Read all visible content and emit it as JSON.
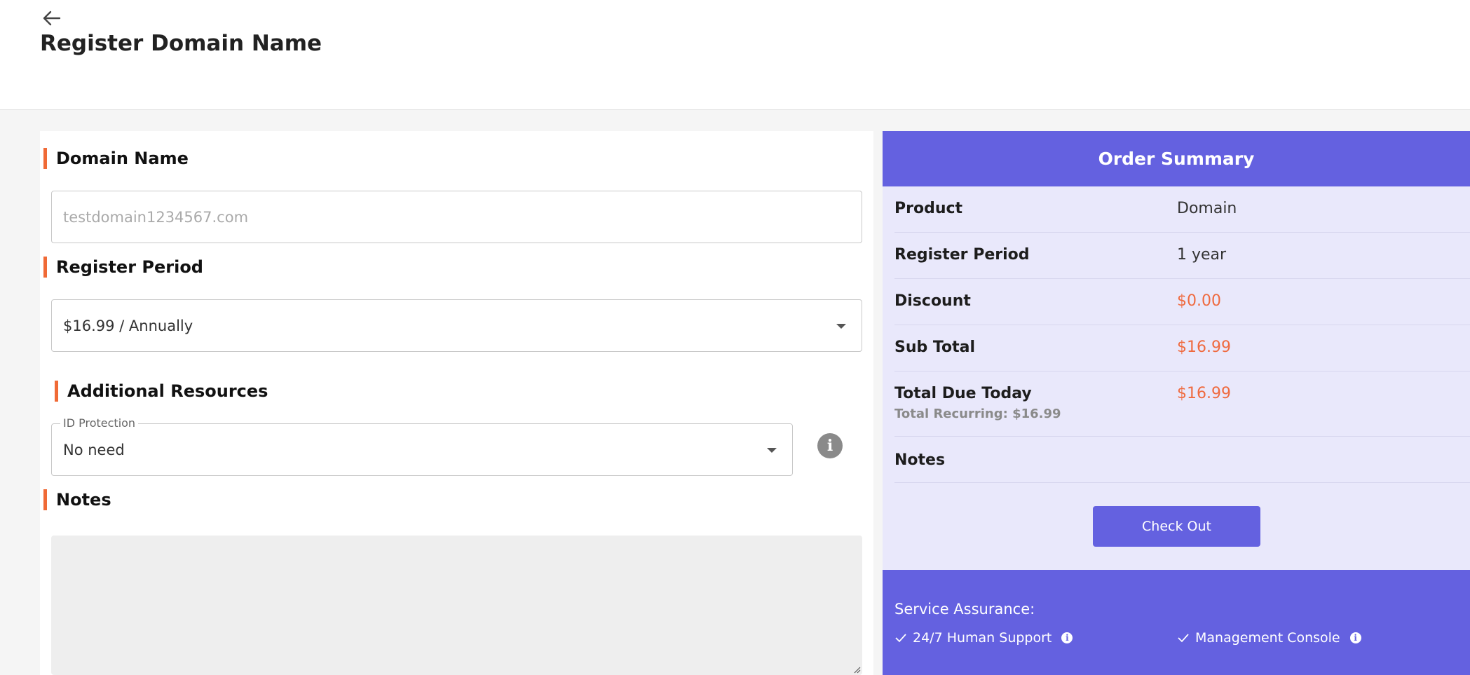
{
  "header": {
    "back_icon": "arrow-left-icon",
    "title": "Register Domain Name"
  },
  "form": {
    "domain_section": {
      "title": "Domain Name",
      "placeholder": "testdomain1234567.com"
    },
    "period_section": {
      "title": "Register Period",
      "selected": "$16.99 / Annually"
    },
    "resources_section": {
      "title": "Additional Resources",
      "id_protection_label": "ID Protection",
      "id_protection_value": "No need",
      "info_icon": "i"
    },
    "notes_section": {
      "title": "Notes"
    }
  },
  "summary": {
    "title": "Order Summary",
    "rows": [
      {
        "label": "Product",
        "value": "Domain"
      },
      {
        "label": "Register Period",
        "value": "1 year"
      },
      {
        "label": "Discount",
        "value": "$0.00"
      },
      {
        "label": "Sub Total",
        "value": "$16.99"
      },
      {
        "label": "Total Due Today",
        "value": "$16.99",
        "sub": "Total Recurring: $16.99"
      },
      {
        "label": "Notes",
        "value": ""
      }
    ],
    "checkout_label": "Check Out",
    "assurance": {
      "title": "Service Assurance:",
      "items": [
        "24/7 Human Support",
        "Management Console"
      ]
    }
  },
  "colors": {
    "accent_orange": "#f06a36",
    "brand_purple": "#6461e0",
    "summary_bg": "#e9e8fb",
    "price_text": "#ef6a3f"
  }
}
